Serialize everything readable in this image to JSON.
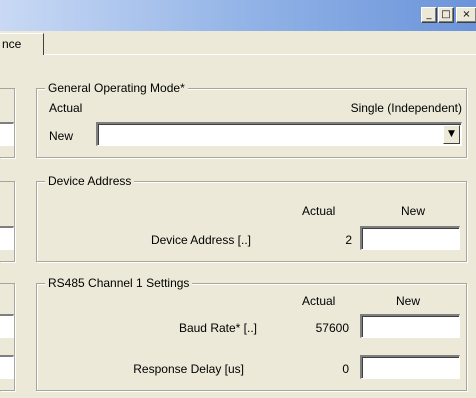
{
  "window": {
    "controls": {
      "minimize": "_",
      "maximize": "□",
      "close": "×"
    }
  },
  "tabs": {
    "visible_label": "nce"
  },
  "general_operating_mode": {
    "title": "General Operating Mode*",
    "actual_label": "Actual",
    "actual_value": "Single (Independent)",
    "new_label": "New",
    "new_value": ""
  },
  "device_address": {
    "title": "Device Address",
    "col_actual": "Actual",
    "col_new": "New",
    "row_label": "Device Address [..]",
    "actual_value": "2",
    "new_value": ""
  },
  "rs485": {
    "title": "RS485 Channel 1 Settings",
    "col_actual": "Actual",
    "col_new": "New",
    "rows": [
      {
        "label": "Baud Rate* [..]",
        "actual": "57600",
        "new": ""
      },
      {
        "label": "Response Delay [us]",
        "actual": "0",
        "new": ""
      }
    ]
  }
}
